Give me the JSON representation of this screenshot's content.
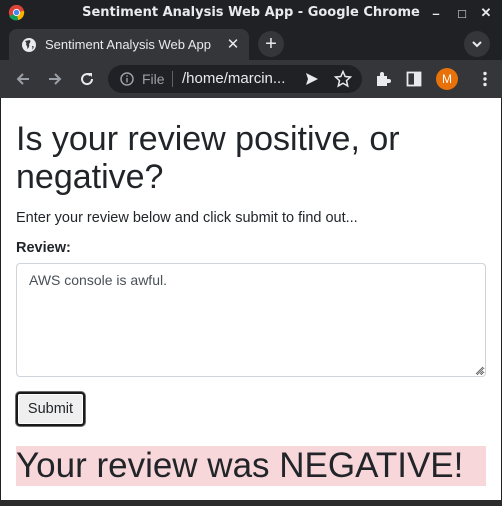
{
  "window": {
    "title": "Sentiment Analysis Web App - Google Chrome",
    "minimize": "–",
    "maximize": "□",
    "close": "✕"
  },
  "tab": {
    "title": "Sentiment Analysis Web App",
    "close": "✕",
    "new_tab": "+"
  },
  "omnibox": {
    "scheme_label": "File",
    "url": "/home/marcin..."
  },
  "profile": {
    "initial": "M",
    "color": "#e8710a"
  },
  "icons": [
    "chrome-logo",
    "globe-icon",
    "back-arrow-icon",
    "forward-arrow-icon",
    "reload-icon",
    "info-icon",
    "share-icon",
    "star-icon",
    "puzzle-icon",
    "side-panel-icon",
    "kebab-menu-icon",
    "chevron-down-icon"
  ],
  "page": {
    "heading": "Is your review positive, or negative?",
    "intro": "Enter your review below and click submit to find out...",
    "review_label": "Review:",
    "review_value": "AWS console is awful.",
    "submit_label": "Submit",
    "result": "Your review was NEGATIVE!",
    "result_bg": "#f8d7da"
  }
}
